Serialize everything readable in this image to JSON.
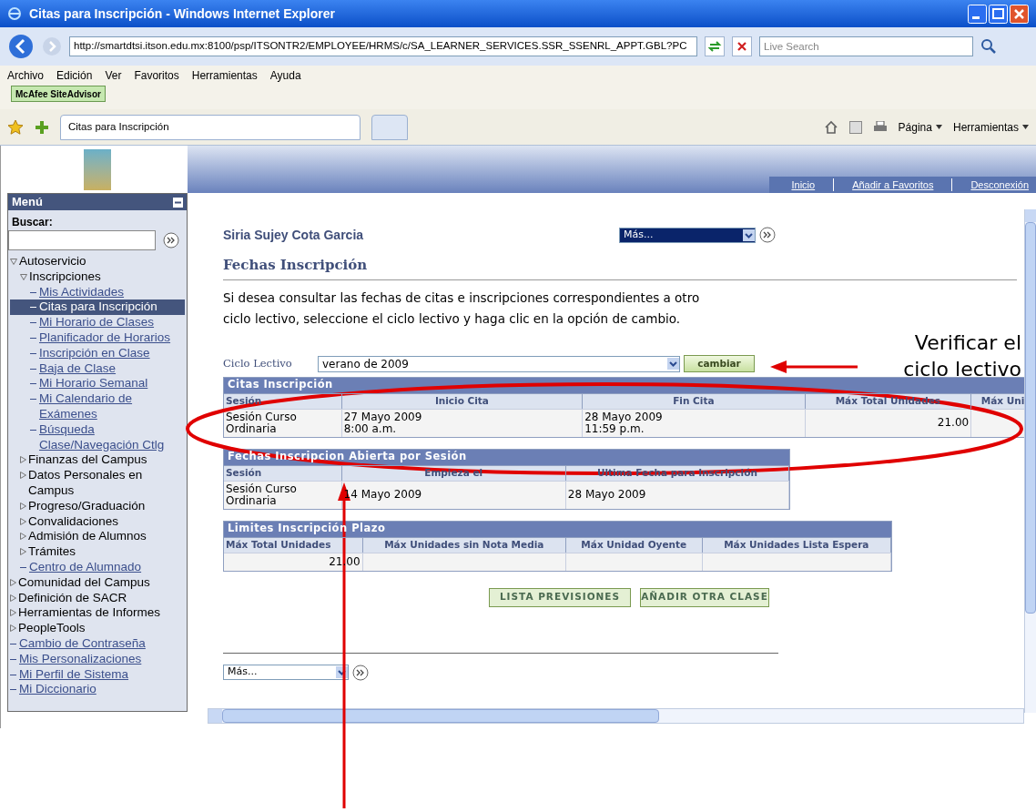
{
  "window": {
    "title": "Citas para Inscripción - Windows Internet Explorer"
  },
  "address_bar": {
    "url": "http://smartdtsi.itson.edu.mx:8100/psp/ITSONTR2/EMPLOYEE/HRMS/c/SA_LEARNER_SERVICES.SSR_SSENRL_APPT.GBL?PC",
    "search_placeholder": "Live Search"
  },
  "menu_bar": [
    "Archivo",
    "Edición",
    "Ver",
    "Favoritos",
    "Herramientas",
    "Ayuda"
  ],
  "addon": "McAfee SiteAdvisor",
  "tabs": [
    {
      "label": "Citas para Inscripción",
      "selected": true
    },
    {
      "selected": false
    }
  ],
  "command_bar": [
    "Página",
    "Herramientas"
  ],
  "header_links": [
    "Inicio",
    "Añadir a Favoritos",
    "Desconexión"
  ],
  "sidebar": {
    "title": "Menú",
    "search_label": "Buscar:",
    "tree": [
      {
        "label": "Autoservicio",
        "kind": "folder",
        "expanded": true,
        "children": [
          {
            "label": "Inscripciones",
            "kind": "folder",
            "expanded": true,
            "children": [
              {
                "label": "Mis Actividades",
                "kind": "link",
                "selected": false
              },
              {
                "label": "Citas para Inscripción",
                "kind": "link",
                "selected": true
              },
              {
                "label": "Mi Horario de Clases",
                "kind": "link",
                "selected": false
              },
              {
                "label": "Planificador de Horarios",
                "kind": "link",
                "selected": false
              },
              {
                "label": "Inscripción en Clase",
                "kind": "link",
                "selected": false
              },
              {
                "label": "Baja de Clase",
                "kind": "link",
                "selected": false
              },
              {
                "label": "Mi Horario Semanal",
                "kind": "link",
                "selected": false
              },
              {
                "label": "Mi Calendario de Exámenes",
                "kind": "link",
                "selected": false
              },
              {
                "label": "Búsqueda Clase/Navegación Ctlg",
                "kind": "link",
                "selected": false
              }
            ]
          },
          {
            "label": "Finanzas del Campus",
            "kind": "folder",
            "expanded": false
          },
          {
            "label": "Datos Personales en Campus",
            "kind": "folder",
            "expanded": false
          },
          {
            "label": "Progreso/Graduación",
            "kind": "folder",
            "expanded": false
          },
          {
            "label": "Convalidaciones",
            "kind": "folder",
            "expanded": false
          },
          {
            "label": "Admisión de Alumnos",
            "kind": "folder",
            "expanded": false
          },
          {
            "label": "Trámites",
            "kind": "folder",
            "expanded": false
          },
          {
            "label": "Centro de Alumnado",
            "kind": "link",
            "selected": false
          }
        ]
      },
      {
        "label": "Comunidad del Campus",
        "kind": "folder",
        "expanded": false
      },
      {
        "label": "Definición de SACR",
        "kind": "folder",
        "expanded": false
      },
      {
        "label": "Herramientas de Informes",
        "kind": "folder",
        "expanded": false
      },
      {
        "label": "PeopleTools",
        "kind": "folder",
        "expanded": false
      },
      {
        "label": "Cambio de Contraseña",
        "kind": "link",
        "selected": false
      },
      {
        "label": "Mis Personalizaciones",
        "kind": "link",
        "selected": false
      },
      {
        "label": "Mi Perfil de Sistema",
        "kind": "link",
        "selected": false
      },
      {
        "label": "Mi Diccionario",
        "kind": "link",
        "selected": false
      }
    ]
  },
  "content": {
    "user_name": "Siria Sujey Cota Garcia",
    "top_select": "Más...",
    "heading": "Fechas Inscripción",
    "intro": "Si desea consultar las fechas de citas e inscripciones correspondientes a otro ciclo lectivo, seleccione el ciclo lectivo y haga clic en la opción de cambio.",
    "term_label": "Ciclo Lectivo",
    "term_value": "verano de 2009",
    "change_button": "cambiar",
    "tables": [
      {
        "title": "Citas Inscripción",
        "columns": [
          "Sesión",
          "Inicio Cita",
          "Fin Cita",
          "Máx Total Unidades",
          "Máx Uni"
        ],
        "rows": [
          [
            "Sesión Curso Ordinaria",
            "27 Mayo 2009\n8:00 a.m.",
            "28 Mayo 2009\n11:59 p.m.",
            "21.00",
            ""
          ]
        ]
      },
      {
        "title": "Fechas Inscripcion Abierta por Sesión",
        "columns": [
          "Sesión",
          "Empieza el",
          "Ultima Fecha para Inscripción"
        ],
        "rows": [
          [
            "Sesión Curso Ordinaria",
            "14 Mayo 2009",
            "28 Mayo 2009"
          ]
        ]
      },
      {
        "title": "Limites Inscripción Plazo",
        "columns": [
          "Máx Total Unidades",
          "Máx Unidades sin Nota Media",
          "Máx Unidad Oyente",
          "Máx Unidades Lista Espera"
        ],
        "rows": [
          [
            "21.00",
            "",
            "",
            ""
          ]
        ]
      }
    ],
    "buttons": [
      "LISTA PREVISIONES",
      "AÑADIR OTRA CLASE"
    ],
    "bottom_select": "Más..."
  },
  "annotation": {
    "callout": "Verificar el ciclo lectivo"
  }
}
